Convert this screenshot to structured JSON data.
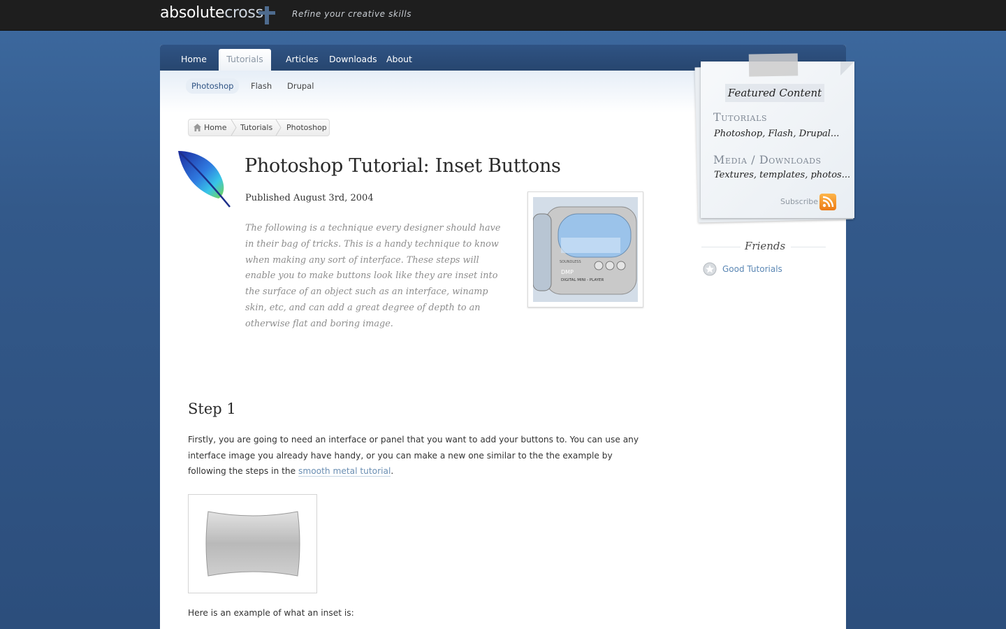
{
  "header": {
    "logo_bold": "absolute",
    "logo_light": "cross",
    "tagline": "Refine your creative skills"
  },
  "nav": {
    "items": [
      "Home",
      "Tutorials",
      "Articles",
      "Downloads",
      "About"
    ],
    "active": "Tutorials"
  },
  "subnav": {
    "items": [
      "Photoshop",
      "Flash",
      "Drupal"
    ],
    "active": "Photoshop"
  },
  "breadcrumb": [
    "Home",
    "Tutorials",
    "Photoshop"
  ],
  "article": {
    "title": "Photoshop Tutorial: Inset Buttons",
    "published": "Published August 3rd, 2004",
    "intro": "The following is a technique every designer should have in their bag of tricks. This is a handy technique to know when making any sort of interface. These steps will enable you to make buttons look like they are inset into the surface of an object such as an interface, winamp skin, etc, and can add a great degree of depth to an otherwise flat and boring image.",
    "thumb_label_1": "SOUNDLESS",
    "thumb_label_2": "DMP",
    "thumb_label_3": "DIGITAL MINI - PLAYER",
    "step1_title": "Step 1",
    "step1_text": "Firstly, you are going to need an interface or panel that you want to add your buttons to. You can use any interface image you already have handy, or you can make a new one similar to the the example by following the steps in the",
    "step1_link": "smooth metal tutorial",
    "step1_end": ".",
    "example_text": "Here is an example of what an inset is:"
  },
  "featured": {
    "title": "Featured Content",
    "tutorials_heading": "Tutorials",
    "tutorials_sub": "Photoshop, Flash, Drupal...",
    "media_heading": "Media / Downloads",
    "media_sub": "Textures, templates, photos...",
    "subscribe": "Subscribe"
  },
  "friends": {
    "title": "Friends",
    "links": [
      "Good Tutorials"
    ]
  },
  "colors": {
    "topbar": "#1e1e1e",
    "nav": "#2f5384",
    "link": "#5b87b4",
    "rss": "#ec7b16"
  }
}
